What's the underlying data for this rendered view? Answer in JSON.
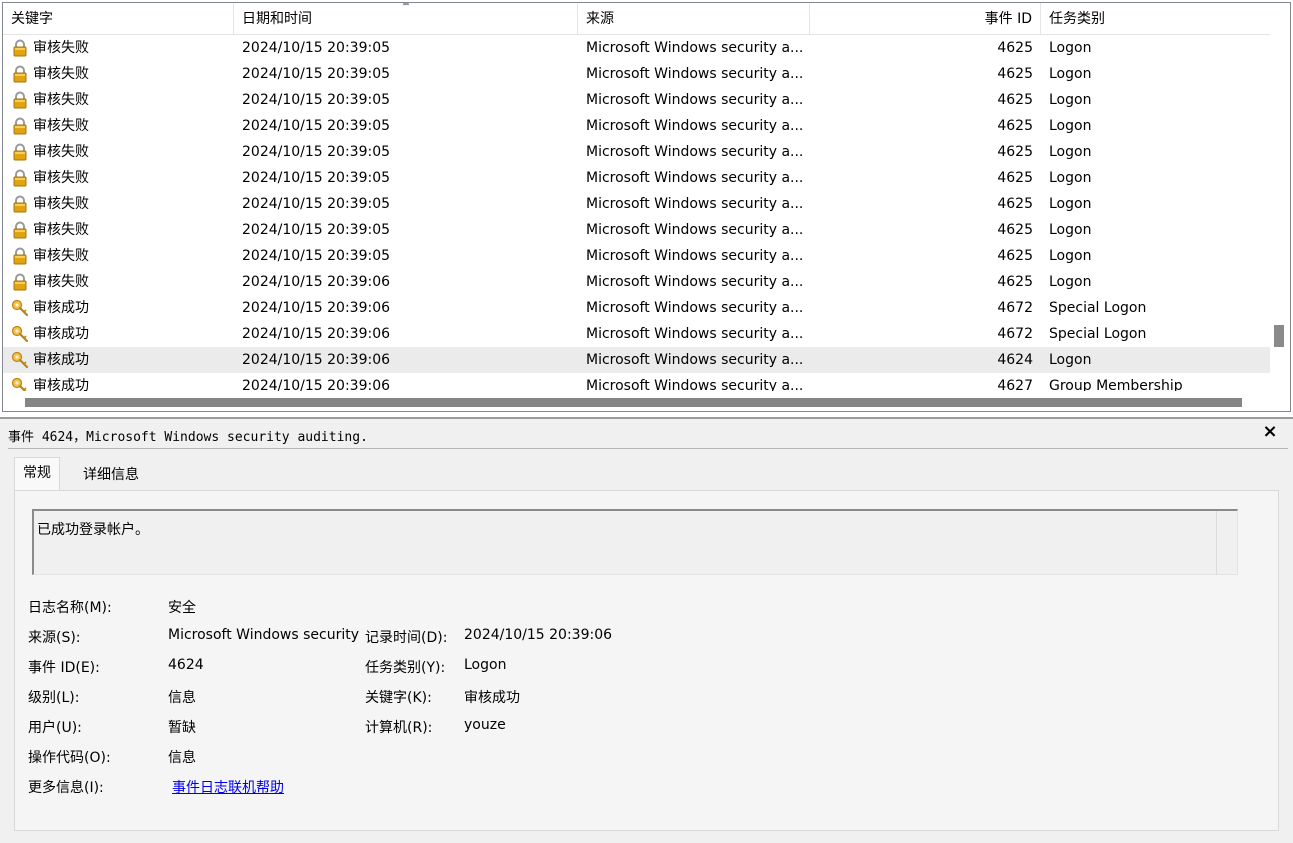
{
  "columns": {
    "keyword": "关键字",
    "datetime": "日期和时间",
    "source": "来源",
    "event_id": "事件 ID",
    "task_category": "任务类别"
  },
  "rows": [
    {
      "icon": "lock-icon",
      "keyword": "审核失败",
      "datetime": "2024/10/15 20:39:05",
      "source": "Microsoft Windows security a...",
      "event_id": "4625",
      "task_category": "Logon"
    },
    {
      "icon": "lock-icon",
      "keyword": "审核失败",
      "datetime": "2024/10/15 20:39:05",
      "source": "Microsoft Windows security a...",
      "event_id": "4625",
      "task_category": "Logon"
    },
    {
      "icon": "lock-icon",
      "keyword": "审核失败",
      "datetime": "2024/10/15 20:39:05",
      "source": "Microsoft Windows security a...",
      "event_id": "4625",
      "task_category": "Logon"
    },
    {
      "icon": "lock-icon",
      "keyword": "审核失败",
      "datetime": "2024/10/15 20:39:05",
      "source": "Microsoft Windows security a...",
      "event_id": "4625",
      "task_category": "Logon"
    },
    {
      "icon": "lock-icon",
      "keyword": "审核失败",
      "datetime": "2024/10/15 20:39:05",
      "source": "Microsoft Windows security a...",
      "event_id": "4625",
      "task_category": "Logon"
    },
    {
      "icon": "lock-icon",
      "keyword": "审核失败",
      "datetime": "2024/10/15 20:39:05",
      "source": "Microsoft Windows security a...",
      "event_id": "4625",
      "task_category": "Logon"
    },
    {
      "icon": "lock-icon",
      "keyword": "审核失败",
      "datetime": "2024/10/15 20:39:05",
      "source": "Microsoft Windows security a...",
      "event_id": "4625",
      "task_category": "Logon"
    },
    {
      "icon": "lock-icon",
      "keyword": "审核失败",
      "datetime": "2024/10/15 20:39:05",
      "source": "Microsoft Windows security a...",
      "event_id": "4625",
      "task_category": "Logon"
    },
    {
      "icon": "lock-icon",
      "keyword": "审核失败",
      "datetime": "2024/10/15 20:39:05",
      "source": "Microsoft Windows security a...",
      "event_id": "4625",
      "task_category": "Logon"
    },
    {
      "icon": "lock-icon",
      "keyword": "审核失败",
      "datetime": "2024/10/15 20:39:06",
      "source": "Microsoft Windows security a...",
      "event_id": "4625",
      "task_category": "Logon"
    },
    {
      "icon": "key-icon",
      "keyword": "审核成功",
      "datetime": "2024/10/15 20:39:06",
      "source": "Microsoft Windows security a...",
      "event_id": "4672",
      "task_category": "Special Logon"
    },
    {
      "icon": "key-icon",
      "keyword": "审核成功",
      "datetime": "2024/10/15 20:39:06",
      "source": "Microsoft Windows security a...",
      "event_id": "4672",
      "task_category": "Special Logon"
    },
    {
      "icon": "key-icon",
      "keyword": "审核成功",
      "datetime": "2024/10/15 20:39:06",
      "source": "Microsoft Windows security a...",
      "event_id": "4624",
      "task_category": "Logon",
      "selected": true
    },
    {
      "icon": "key-icon",
      "keyword": "审核成功",
      "datetime": "2024/10/15 20:39:06",
      "source": "Microsoft Windows security a...",
      "event_id": "4627",
      "task_category": "Group Membership"
    }
  ],
  "detail": {
    "title": "事件 4624，Microsoft Windows security auditing.",
    "close_glyph": "×",
    "tabs": [
      "常规",
      "详细信息"
    ],
    "description": "已成功登录帐户。",
    "labels": {
      "log_name": "日志名称(M):",
      "source": "来源(S):",
      "event_id": "事件 ID(E):",
      "level": "级别(L):",
      "user": "用户(U):",
      "opcode": "操作代码(O):",
      "more_info": "更多信息(I):",
      "logged": "记录时间(D):",
      "task_category": "任务类别(Y):",
      "keywords": "关键字(K):",
      "computer": "计算机(R):"
    },
    "values": {
      "log_name": "安全",
      "source": "Microsoft Windows security",
      "event_id": "4624",
      "level": "信息",
      "user": "暂缺",
      "opcode": "信息",
      "more_info_link": "事件日志联机帮助",
      "logged": "2024/10/15 20:39:06",
      "task_category": "Logon",
      "keywords": "审核成功",
      "computer": "youze"
    }
  },
  "colors": {
    "selected_row": "#ebebeb",
    "link": "#0000ee",
    "lock_body": "#e0a412",
    "key_color": "#d8a11b"
  }
}
